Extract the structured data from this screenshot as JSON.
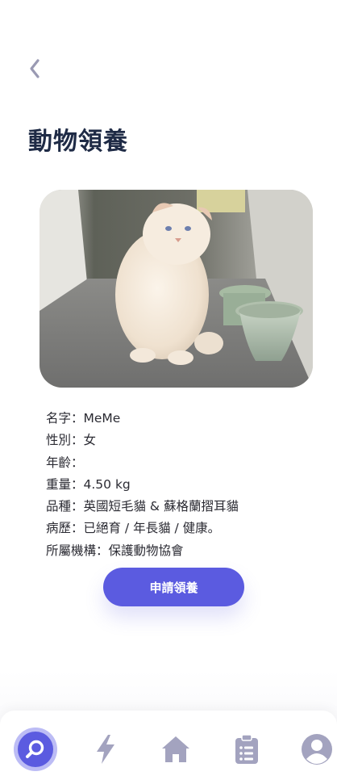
{
  "header": {
    "title": "動物領養"
  },
  "pet": {
    "name_row": "名字：MeMe",
    "gender_row": "性別：女",
    "age_row": "年齡：",
    "weight_row": "重量：4.50 kg",
    "breed_row": "品種：英國短毛貓 & 蘇格蘭摺耳貓",
    "history_row": "病歷：已絕育 / 年長貓 / 健康。",
    "org_row": "所屬機構：保護動物協會"
  },
  "actions": {
    "adopt_label": "申請領養"
  },
  "nav": {
    "items": [
      {
        "icon": "search-icon",
        "active": true
      },
      {
        "icon": "lightning-icon",
        "active": false
      },
      {
        "icon": "home-icon",
        "active": false
      },
      {
        "icon": "clipboard-icon",
        "active": false
      },
      {
        "icon": "user-icon",
        "active": false
      }
    ]
  },
  "colors": {
    "accent": "#5b5be0",
    "accent_light": "#bcbcf5",
    "title": "#1f2b46",
    "icon_inactive": "#a3a3bf",
    "text": "#2b2b33"
  }
}
